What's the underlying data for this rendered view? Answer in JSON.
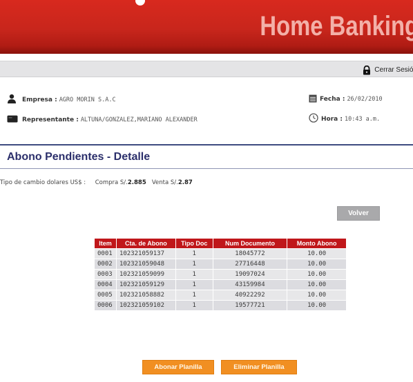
{
  "header": {
    "title": "Home Banking"
  },
  "logout": {
    "label": "Cerrar Sesión"
  },
  "info": {
    "empresa_label": "Empresa :",
    "empresa_value": "AGRO MORIN S.A.C",
    "representante_label": "Representante :",
    "representante_value": "ALTUNA/GONZALEZ,MARIANO ALEXANDER",
    "fecha_label": "Fecha :",
    "fecha_value": "26/02/2010",
    "hora_label": "Hora :",
    "hora_value": "10:43 a.m."
  },
  "section": {
    "title": "Abono Pendientes - Detalle"
  },
  "exchange": {
    "label": "Tipo de cambio dolares US$ :",
    "compra_label": "Compra S/.",
    "compra_value": "2.885",
    "venta_label": "Venta S/.",
    "venta_value": "2.87"
  },
  "buttons": {
    "back": "Volver",
    "abonar": "Abonar Planilla",
    "eliminar": "Eliminar Planilla"
  },
  "table": {
    "headers": [
      "Item",
      "Cta. de Abono",
      "Tipo Doc",
      "Num Documento",
      "Monto Abono"
    ],
    "rows": [
      [
        "0001",
        "102321059137",
        "1",
        "18045772",
        "10.00"
      ],
      [
        "0002",
        "102321059048",
        "1",
        "27716448",
        "10.00"
      ],
      [
        "0003",
        "102321059099",
        "1",
        "19097024",
        "10.00"
      ],
      [
        "0004",
        "102321059129",
        "1",
        "43159984",
        "10.00"
      ],
      [
        "0005",
        "102321058882",
        "1",
        "40922292",
        "10.00"
      ],
      [
        "0006",
        "102321059102",
        "1",
        "19577721",
        "10.00"
      ]
    ]
  },
  "colors": {
    "brand_red": "#c8261c",
    "header_text": "#f3b0a8",
    "title_blue": "#2b2f6b",
    "button_orange": "#f18f22",
    "button_gray": "#a9a9ab"
  },
  "icons": [
    "person-icon",
    "card-icon",
    "calendar-icon",
    "clock-icon",
    "lock-icon"
  ]
}
